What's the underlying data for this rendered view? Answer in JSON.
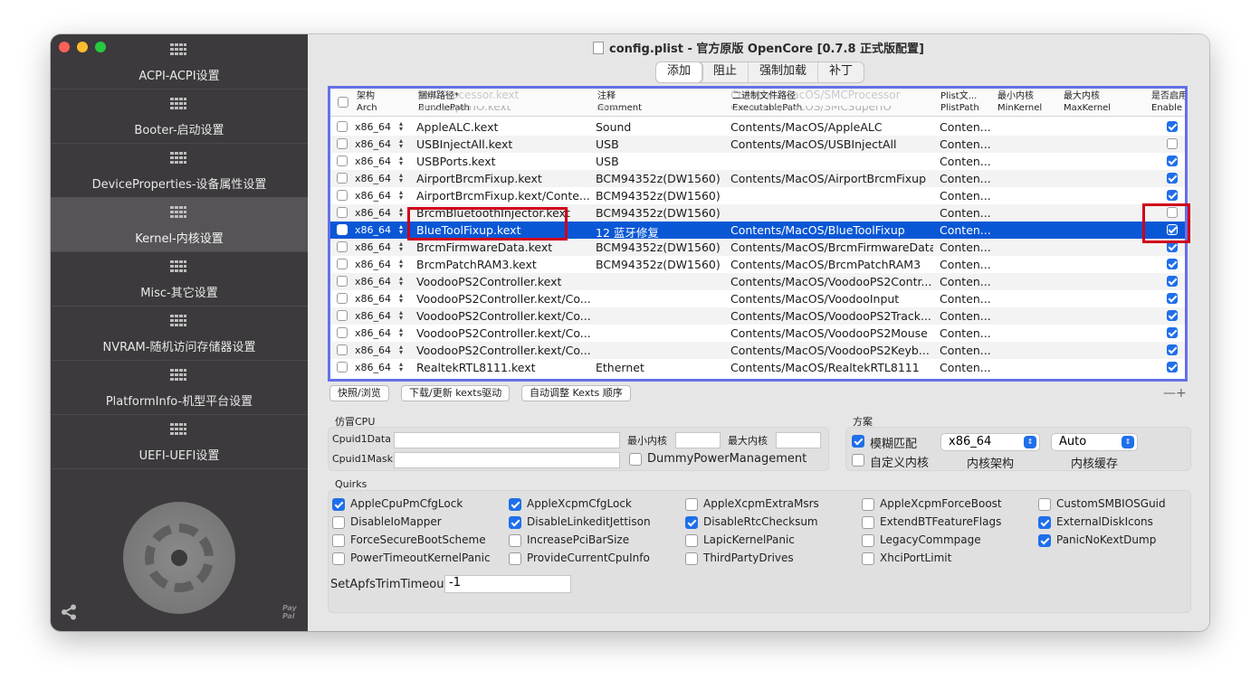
{
  "window": {
    "title": "config.plist - 官方原版 OpenCore [0.7.8 正式版配置]"
  },
  "sidebar": {
    "items": [
      {
        "label": "ACPI-ACPI设置"
      },
      {
        "label": "Booter-启动设置"
      },
      {
        "label": "DeviceProperties-设备属性设置"
      },
      {
        "label": "Kernel-内核设置"
      },
      {
        "label": "Misc-其它设置"
      },
      {
        "label": "NVRAM-随机访问存储器设置"
      },
      {
        "label": "PlatformInfo-机型平台设置"
      },
      {
        "label": "UEFI-UEFI设置"
      }
    ],
    "active_index": 3,
    "paypal_label": "Pay Pal"
  },
  "tabs": [
    "添加",
    "阻止",
    "强制加载",
    "补丁"
  ],
  "active_tab": 0,
  "table": {
    "headers": [
      {
        "zh": "架构",
        "en": "Arch"
      },
      {
        "zh": "捆绑路径*",
        "en": "BundlePath"
      },
      {
        "zh": "注释",
        "en": "Comment"
      },
      {
        "zh": "二进制文件路径",
        "en": "ExecutablePath"
      },
      {
        "zh": "Plist文...",
        "en": "PlistPath"
      },
      {
        "zh": "最小内核",
        "en": "MinKernel"
      },
      {
        "zh": "最大内核",
        "en": "MaxKernel"
      },
      {
        "zh": "是否启用",
        "en": "Enable"
      }
    ],
    "ghost_rows": [
      {
        "bundle": "SMCProcessor.kext",
        "exec": "Contents/MacOS/SMCProcessor"
      },
      {
        "bundle": "SMCSuperIO.kext",
        "comment": "SMC",
        "exec": "Contents/MacOS/SMCSuperIO"
      }
    ],
    "rows": [
      {
        "arch": "x86_64",
        "bundle": "AppleALC.kext",
        "comment": "Sound",
        "exec": "Contents/MacOS/AppleALC",
        "plist": "Conten...",
        "enabled": true
      },
      {
        "arch": "x86_64",
        "bundle": "USBInjectAll.kext",
        "comment": "USB",
        "exec": "Contents/MacOS/USBInjectAll",
        "plist": "Conten...",
        "enabled": false
      },
      {
        "arch": "x86_64",
        "bundle": "USBPorts.kext",
        "comment": "USB",
        "exec": "",
        "plist": "Conten...",
        "enabled": true
      },
      {
        "arch": "x86_64",
        "bundle": "AirportBrcmFixup.kext",
        "comment": "BCM94352z(DW1560)",
        "exec": "Contents/MacOS/AirportBrcmFixup",
        "plist": "Conten...",
        "enabled": true
      },
      {
        "arch": "x86_64",
        "bundle": "AirportBrcmFixup.kext/Conte...",
        "comment": "BCM94352z(DW1560)",
        "exec": "",
        "plist": "Conten...",
        "enabled": true
      },
      {
        "arch": "x86_64",
        "bundle": "BrcmBluetoothInjector.kext",
        "comment": "BCM94352z(DW1560)",
        "exec": "",
        "plist": "Conten...",
        "enabled": false
      },
      {
        "arch": "x86_64",
        "bundle": "BlueToolFixup.kext",
        "comment": "12 蓝牙修复",
        "exec": "Contents/MacOS/BlueToolFixup",
        "plist": "Conten...",
        "enabled": true,
        "selected": true
      },
      {
        "arch": "x86_64",
        "bundle": "BrcmFirmwareData.kext",
        "comment": "BCM94352z(DW1560)",
        "exec": "Contents/MacOS/BrcmFirmwareData",
        "plist": "Conten...",
        "enabled": true
      },
      {
        "arch": "x86_64",
        "bundle": "BrcmPatchRAM3.kext",
        "comment": "BCM94352z(DW1560)",
        "exec": "Contents/MacOS/BrcmPatchRAM3",
        "plist": "Conten...",
        "enabled": true
      },
      {
        "arch": "x86_64",
        "bundle": "VoodooPS2Controller.kext",
        "comment": "",
        "exec": "Contents/MacOS/VoodooPS2Contr...",
        "plist": "Conten...",
        "enabled": true
      },
      {
        "arch": "x86_64",
        "bundle": "VoodooPS2Controller.kext/Co...",
        "comment": "",
        "exec": "Contents/MacOS/VoodooInput",
        "plist": "Conten...",
        "enabled": true
      },
      {
        "arch": "x86_64",
        "bundle": "VoodooPS2Controller.kext/Co...",
        "comment": "",
        "exec": "Contents/MacOS/VoodooPS2Track...",
        "plist": "Conten...",
        "enabled": true
      },
      {
        "arch": "x86_64",
        "bundle": "VoodooPS2Controller.kext/Co...",
        "comment": "",
        "exec": "Contents/MacOS/VoodooPS2Mouse",
        "plist": "Conten...",
        "enabled": true
      },
      {
        "arch": "x86_64",
        "bundle": "VoodooPS2Controller.kext/Co...",
        "comment": "",
        "exec": "Contents/MacOS/VoodooPS2Keyb...",
        "plist": "Conten...",
        "enabled": true
      },
      {
        "arch": "x86_64",
        "bundle": "RealtekRTL8111.kext",
        "comment": "Ethernet",
        "exec": "Contents/MacOS/RealtekRTL8111",
        "plist": "Conten...",
        "enabled": true
      }
    ]
  },
  "table_buttons": {
    "snapshot": "快照/浏览",
    "download": "下载/更新 kexts驱动",
    "auto_order": "自动调整 Kexts 顺序",
    "add_remove": "—+"
  },
  "emulate": {
    "group_label": "仿冒CPU",
    "cpuid1data_label": "Cpuid1Data",
    "cpuid1mask_label": "Cpuid1Mask",
    "cpuid1data_value": "",
    "cpuid1mask_value": "",
    "min_kernel_label": "最小内核",
    "max_kernel_label": "最大内核",
    "min_kernel_value": "",
    "max_kernel_value": "",
    "dummy_power": "DummyPowerManagement",
    "dummy_power_checked": false
  },
  "scheme": {
    "group_label": "方案",
    "fuzzy_match": "模糊匹配",
    "fuzzy_checked": true,
    "custom_kernel": "自定义内核",
    "custom_checked": false,
    "kernel_arch_value": "x86_64",
    "kernel_arch_label": "内核架构",
    "kernel_cache_value": "Auto",
    "kernel_cache_label": "内核缓存"
  },
  "quirks": {
    "group_label": "Quirks",
    "items": [
      {
        "label": "AppleCpuPmCfgLock",
        "checked": true
      },
      {
        "label": "AppleXcpmCfgLock",
        "checked": true
      },
      {
        "label": "AppleXcpmExtraMsrs",
        "checked": false
      },
      {
        "label": "AppleXcpmForceBoost",
        "checked": false
      },
      {
        "label": "CustomSMBIOSGuid",
        "checked": false
      },
      {
        "label": "DisableIoMapper",
        "checked": false
      },
      {
        "label": "DisableLinkeditJettison",
        "checked": true
      },
      {
        "label": "DisableRtcChecksum",
        "checked": true
      },
      {
        "label": "ExtendBTFeatureFlags",
        "checked": false
      },
      {
        "label": "ExternalDiskIcons",
        "checked": true
      },
      {
        "label": "ForceSecureBootScheme",
        "checked": false
      },
      {
        "label": "IncreasePciBarSize",
        "checked": false
      },
      {
        "label": "LapicKernelPanic",
        "checked": false
      },
      {
        "label": "LegacyCommpage",
        "checked": false
      },
      {
        "label": "PanicNoKextDump",
        "checked": true
      },
      {
        "label": "PowerTimeoutKernelPanic",
        "checked": false
      },
      {
        "label": "ProvideCurrentCpuInfo",
        "checked": false
      },
      {
        "label": "ThirdPartyDrives",
        "checked": false
      },
      {
        "label": "XhciPortLimit",
        "checked": false
      }
    ],
    "apfs_trim_label": "SetApfsTrimTimeout",
    "apfs_trim_value": "-1"
  },
  "colors": {
    "selection": "#0a57d6",
    "checkbox_on": "#1f6fea",
    "highlight_box": "#d0021b",
    "table_border": "#6470e6",
    "sidebar_bg": "#3c3a3c"
  }
}
